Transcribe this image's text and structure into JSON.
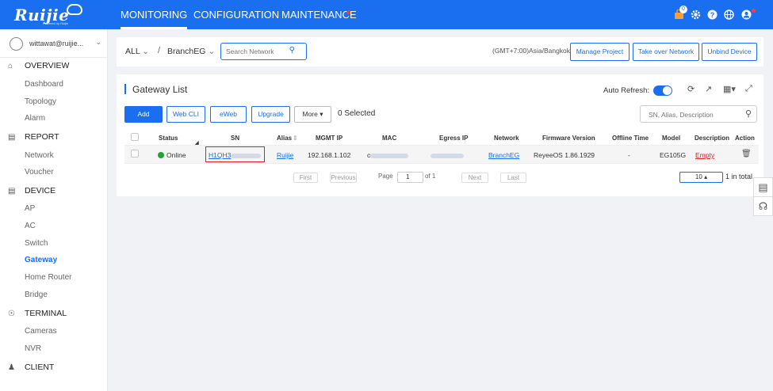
{
  "brand": {
    "logo_text": "Ruijie",
    "logo_sub": "Powered by Ruijie"
  },
  "topnav": {
    "monitoring": "MONITORING",
    "configuration": "CONFIGURATION",
    "maintenance": "MAINTENANCE",
    "notif_count": "0"
  },
  "sidebar": {
    "user": "wittawat@ruijie...",
    "sections": {
      "overview": "OVERVIEW",
      "report": "REPORT",
      "device": "DEVICE",
      "terminal": "TERMINAL",
      "client": "CLIENT"
    },
    "items": {
      "dashboard": "Dashboard",
      "topology": "Topology",
      "alarm": "Alarm",
      "network": "Network",
      "voucher": "Voucher",
      "ap": "AP",
      "ac": "AC",
      "switch": "Switch",
      "gateway": "Gateway",
      "home_router": "Home Router",
      "bridge": "Bridge",
      "cameras": "Cameras",
      "nvr": "NVR"
    }
  },
  "header": {
    "scope": "ALL",
    "network": "BranchEG",
    "search_placeholder": "Search Network",
    "timezone": "(GMT+7:00)Asia/Bangkok",
    "manage_project": "Manage Project",
    "take_over": "Take over Network",
    "unbind": "Unbind Device"
  },
  "gateway": {
    "title": "Gateway List",
    "auto_refresh": "Auto Refresh:",
    "auto_refresh_on": true,
    "buttons": {
      "add": "Add",
      "web_cli": "Web CLI",
      "eweb": "eWeb",
      "upgrade": "Upgrade",
      "more": "More"
    },
    "selected": "0 Selected",
    "search_placeholder": "SN, Alias, Description",
    "columns": [
      "Status",
      "SN",
      "Alias",
      "MGMT IP",
      "MAC",
      "Egress IP",
      "Network",
      "Firmware Version",
      "Offline Time",
      "Model",
      "Description",
      "Action"
    ],
    "row": {
      "status": "Online",
      "sn": "H1QH3",
      "alias": "Ruijie",
      "mgmt_ip": "192.168.1.102",
      "mac_prefix": "c",
      "network": "BranchEG",
      "firmware": "ReyeeOS 1.86.1929",
      "offline_time": "-",
      "model": "EG105G",
      "description": "Empty"
    },
    "pagination": {
      "first": "First",
      "previous": "Previous",
      "page_label": "Page",
      "page": "1",
      "of": "of 1",
      "next": "Next",
      "last": "Last",
      "size": "10",
      "total": "1 in total"
    }
  },
  "colors": {
    "primary": "#1a6ef0",
    "online": "#22a33a",
    "danger": "#e02020"
  }
}
